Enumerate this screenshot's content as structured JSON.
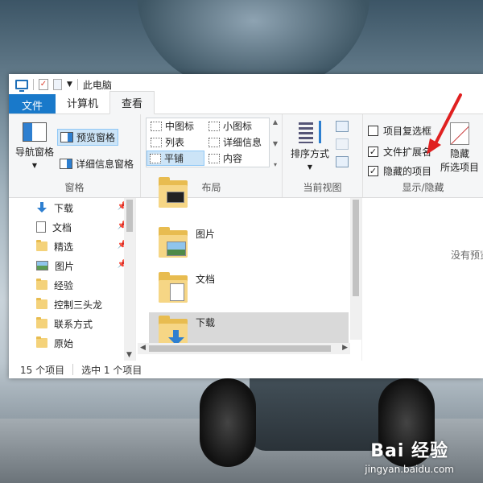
{
  "window": {
    "title": "此电脑"
  },
  "ribbon_tabs": [
    {
      "label": "文件"
    },
    {
      "label": "计算机"
    },
    {
      "label": "查看"
    }
  ],
  "groups": {
    "pane": {
      "label": "窗格",
      "nav_pane": "导航窗格",
      "preview_pane": "预览窗格",
      "details_pane": "详细信息窗格"
    },
    "layout": {
      "label": "布局",
      "items": [
        "中图标",
        "小图标",
        "列表",
        "详细信息",
        "平铺",
        "内容"
      ]
    },
    "current_view": {
      "label": "当前视图",
      "sort_by": "排序方式"
    },
    "show_hide": {
      "label": "显示/隐藏",
      "item_checkboxes": {
        "label": "项目复选框",
        "checked": false
      },
      "file_extensions": {
        "label": "文件扩展名",
        "checked": true
      },
      "hidden_items": {
        "label": "隐藏的项目",
        "checked": true
      },
      "hide_selected_line1": "隐藏",
      "hide_selected_line2": "所选项目"
    }
  },
  "nav_items": [
    "下载",
    "文档",
    "精选",
    "图片",
    "经验",
    "控制三头龙",
    "联系方式",
    "原始"
  ],
  "content_items": [
    "图片",
    "文档",
    "下载"
  ],
  "preview": {
    "text": "没有预览"
  },
  "statusbar": {
    "count": "15 个项目",
    "selected": "选中 1 个项目"
  },
  "watermark": {
    "logo": "Bai 经验",
    "url": "jingyan.baidu.com"
  },
  "colors": {
    "accent": "#1979ca",
    "selection": "#cce4f7",
    "annotation_arrow": "#e02020"
  }
}
